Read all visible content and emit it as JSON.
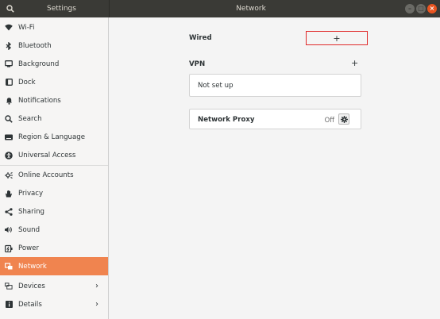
{
  "header": {
    "left_title": "Settings",
    "title": "Network",
    "window_buttons": [
      "minimize",
      "maximize",
      "close"
    ]
  },
  "sidebar": {
    "items": [
      {
        "label": "Wi-Fi",
        "icon": "wifi-icon"
      },
      {
        "label": "Bluetooth",
        "icon": "bluetooth-icon"
      },
      {
        "label": "Background",
        "icon": "background-icon"
      },
      {
        "label": "Dock",
        "icon": "dock-icon"
      },
      {
        "label": "Notifications",
        "icon": "bell-icon"
      },
      {
        "label": "Search",
        "icon": "search-icon"
      },
      {
        "label": "Region & Language",
        "icon": "keyboard-icon"
      },
      {
        "label": "Universal Access",
        "icon": "accessibility-icon"
      },
      {
        "label": "Online Accounts",
        "icon": "online-accounts-icon"
      },
      {
        "label": "Privacy",
        "icon": "hand-icon"
      },
      {
        "label": "Sharing",
        "icon": "share-icon"
      },
      {
        "label": "Sound",
        "icon": "speaker-icon"
      },
      {
        "label": "Power",
        "icon": "power-icon"
      },
      {
        "label": "Network",
        "icon": "network-icon",
        "active": true
      },
      {
        "label": "Devices",
        "icon": "devices-icon",
        "chevron": true
      },
      {
        "label": "Details",
        "icon": "info-icon",
        "chevron": true
      }
    ]
  },
  "main": {
    "wired_label": "Wired",
    "wired_add": "+",
    "vpn_label": "VPN",
    "vpn_add": "+",
    "vpn_status": "Not set up",
    "proxy_label": "Network Proxy",
    "proxy_state": "Off"
  },
  "colors": {
    "header_bg": "#3a3a36",
    "accent": "#f0844f",
    "close_button": "#e95420",
    "highlight_border": "#e02a2a"
  }
}
